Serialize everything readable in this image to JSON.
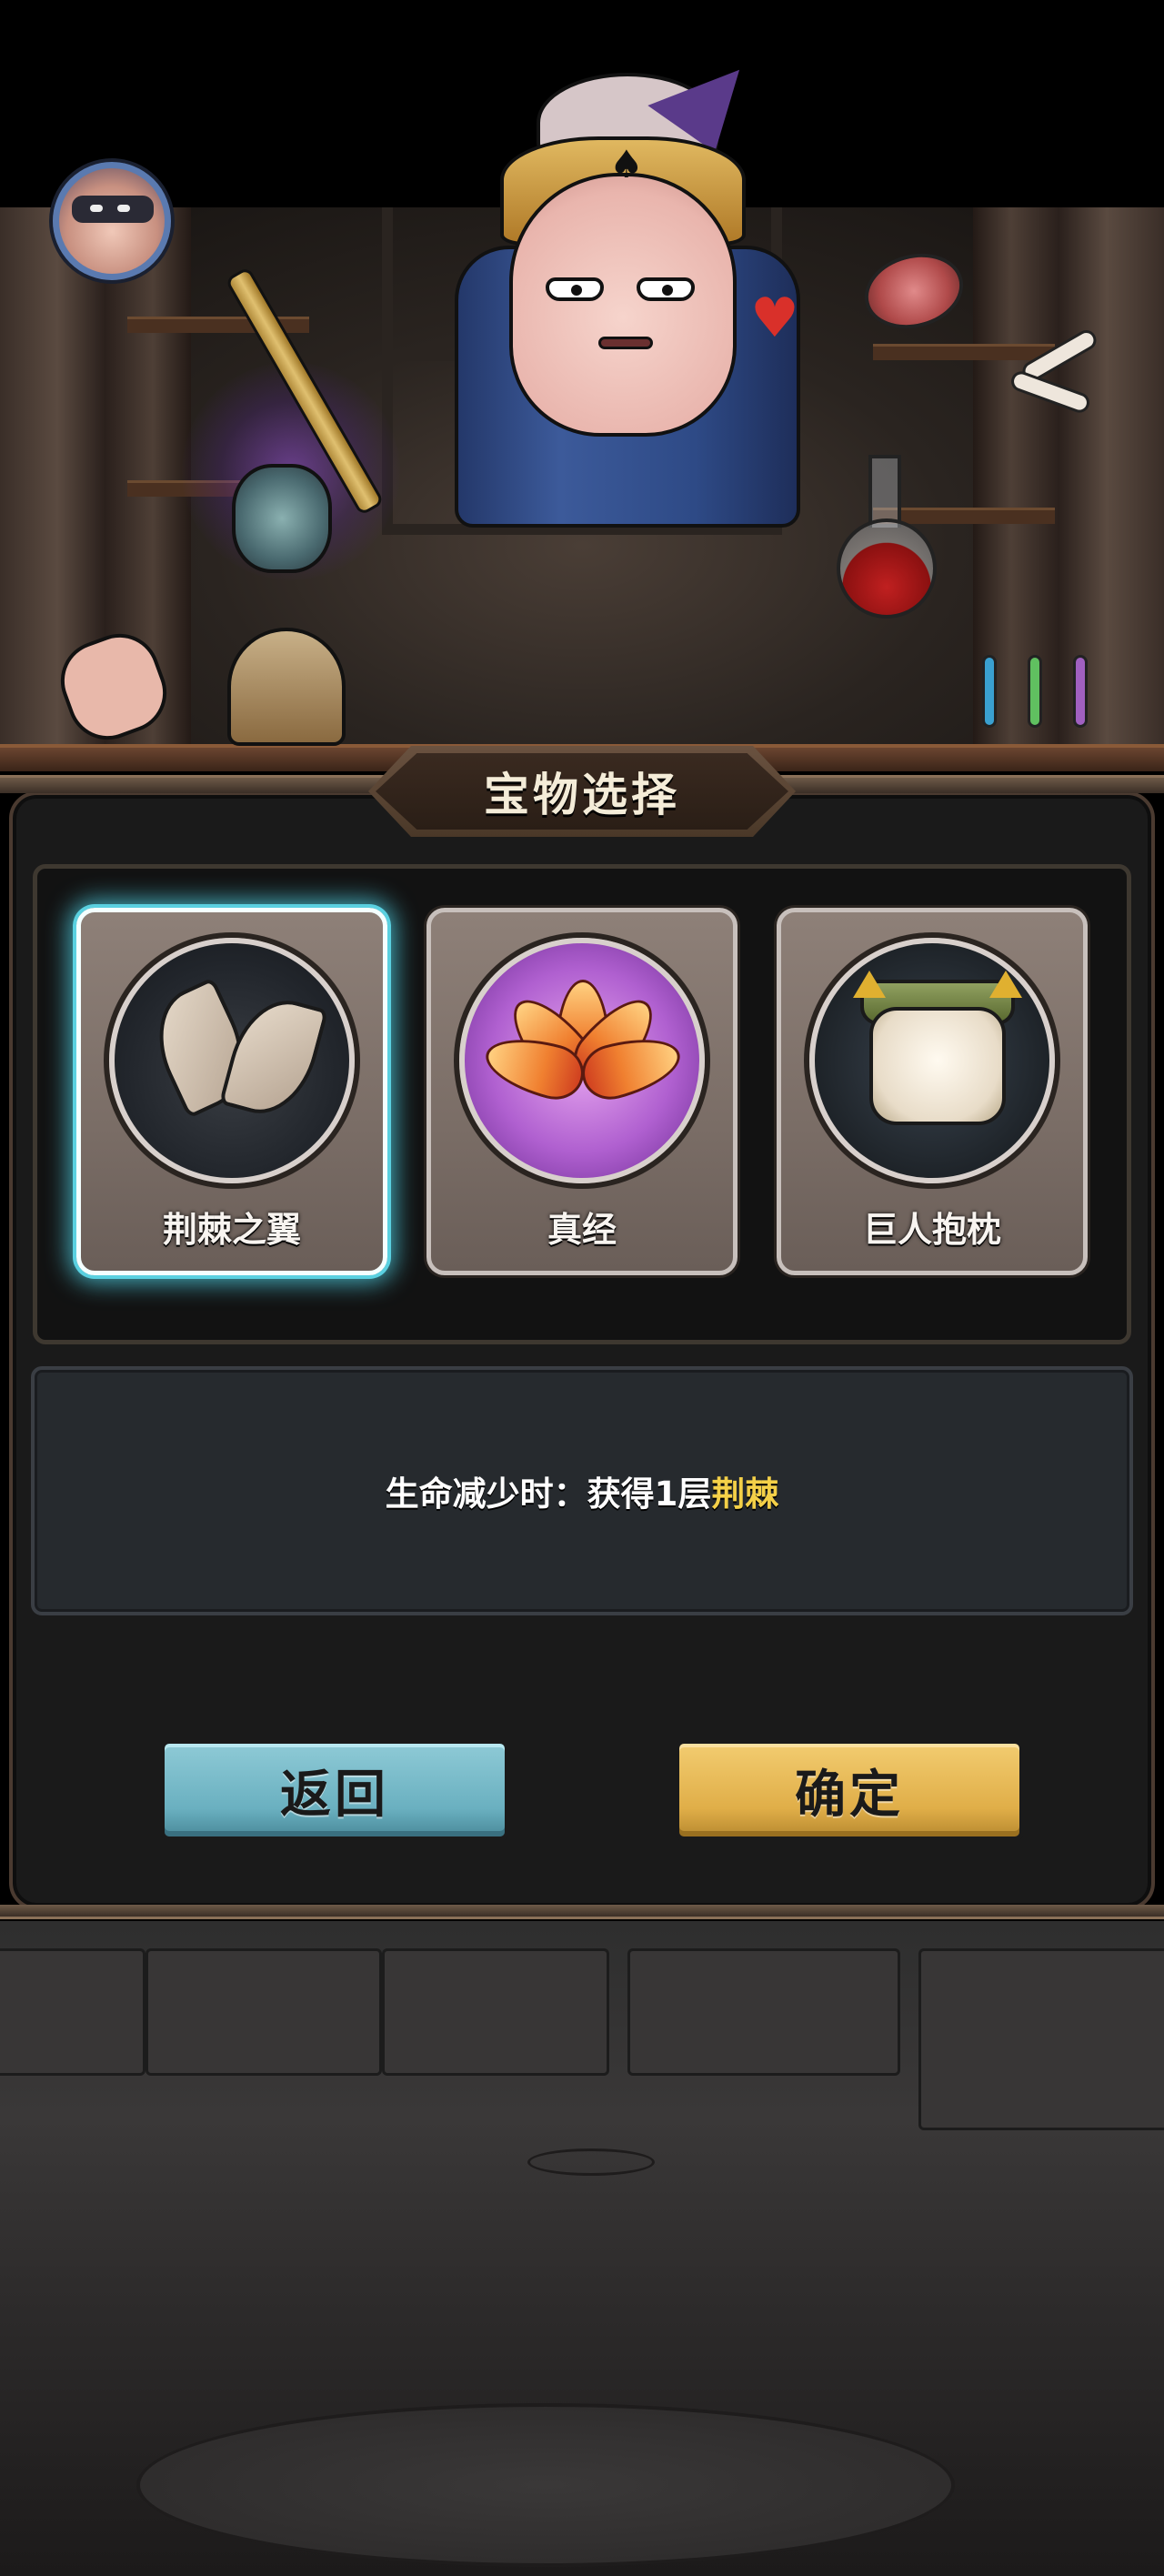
{
  "screen": "treasure-selection",
  "title": "宝物选择",
  "treasures": [
    {
      "name": "荆棘之翼",
      "icon": "thorn-wings-icon",
      "selected": true
    },
    {
      "name": "真经",
      "icon": "lotus-scripture-icon",
      "selected": false
    },
    {
      "name": "巨人抱枕",
      "icon": "giant-pillow-icon",
      "selected": false
    }
  ],
  "description": {
    "prefix": "生命减少时：获得1层",
    "highlight": "荆棘",
    "highlight_color": "#f4d048"
  },
  "buttons": {
    "back_label": "返回",
    "confirm_label": "确定",
    "back_color": "#6ab0c0",
    "confirm_color": "#e0ae48"
  },
  "avatar": {
    "icon": "player-avatar-icon"
  },
  "colors": {
    "selection_glow": "#5ad0e0",
    "panel_bg": "#1a1a1a",
    "description_bg": "#262a2e"
  }
}
